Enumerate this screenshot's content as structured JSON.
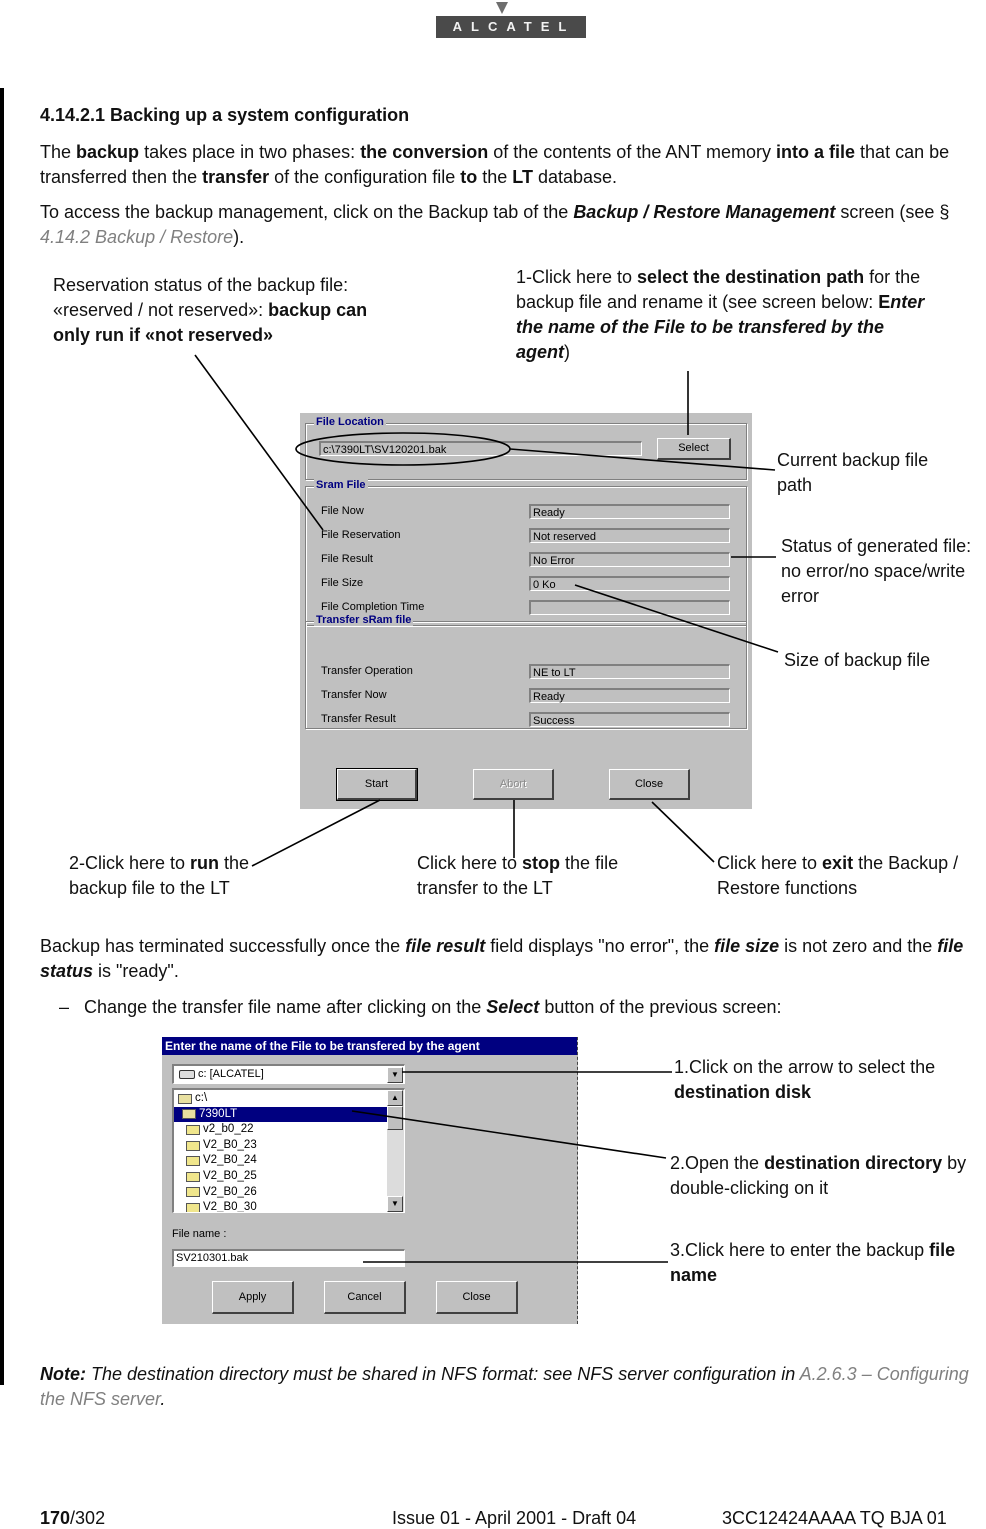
{
  "logo": {
    "text": "ALCATEL"
  },
  "heading": "4.14.2.1  Backing up a system configuration",
  "para1": {
    "t1": "The ",
    "b1": "backup",
    "t2": " takes place in two phases: ",
    "b2": "the conversion",
    "t3": " of the contents of the ANT memory ",
    "b3": "into a file",
    "t4": " that can be transferred then the ",
    "b4": "transfer",
    "t5": " of the configuration file ",
    "b5": "to",
    "t6": " the ",
    "b6": "LT",
    "t7": " database."
  },
  "para2": {
    "t1": "To access the backup management, click on the Backup tab of the ",
    "bi1": "Backup  / Restore Management",
    "t2": " screen (see § ",
    "ref": "4.14.2 Backup / Restore",
    "t3": ")."
  },
  "annotations_top": {
    "reservation": {
      "t1": "Reservation status of the backup file: «reserved / not reserved»: ",
      "b1": "backup can only run if «not reserved»"
    },
    "select": {
      "t1": "1-Click here to ",
      "b1": "select the destination path",
      "t2": " for the backup file and rename it (see screen below: ",
      "b2": "E",
      "bi1": "nter the name of the File to be transfered by the agent",
      "t3": ")"
    },
    "current_path": "Current backup file path",
    "status": "Status of generated file: no error/no space/write error",
    "size": "Size of backup file",
    "run": {
      "t1": "2-Click here to ",
      "b1": "run",
      "t2": " the backup file to the LT"
    },
    "stop": {
      "t1": "Click here to ",
      "b1": "stop",
      "t2": " the file transfer to the LT"
    },
    "exit": {
      "t1": "Click here to ",
      "b1": "exit",
      "t2": " the Backup / Restore functions"
    }
  },
  "backup_dialog": {
    "file_location": {
      "title": "File Location",
      "path": "c:\\7390LT\\SV120201.bak",
      "select_label": "Select"
    },
    "sram_file": {
      "title": "Sram File",
      "rows": [
        {
          "label": "File Now",
          "value": "Ready"
        },
        {
          "label": "File Reservation",
          "value": "Not reserved"
        },
        {
          "label": "File Result",
          "value": "No Error"
        },
        {
          "label": "File Size",
          "value": "0 Ko"
        },
        {
          "label": "File Completion Time",
          "value": ""
        }
      ]
    },
    "transfer": {
      "title": "Transfer sRam file",
      "rows": [
        {
          "label": "Transfer Operation",
          "value": "NE to LT"
        },
        {
          "label": "Transfer Now",
          "value": "Ready"
        },
        {
          "label": "Transfer Result",
          "value": "Success"
        }
      ]
    },
    "buttons": {
      "start": "Start",
      "abort": "Abort",
      "close": "Close"
    }
  },
  "para3": {
    "t1": "Backup has terminated successfully once the ",
    "bi1": "file result",
    "t2": " field displays \"no error\", the ",
    "bi2": "file size",
    "t3": " is not zero and the ",
    "bi3": "file status",
    "t4": " is \"ready\"."
  },
  "bullet": {
    "dash": "–",
    "t1": "Change the transfer file name after clicking on the ",
    "bi1": "Select",
    "t2": " button of the previous screen:"
  },
  "file_dialog": {
    "title": "Enter the name of the File to be transfered by the agent",
    "drive": "c: [ALCATEL]",
    "folders": [
      {
        "name": "c:\\",
        "open": true,
        "selected": false
      },
      {
        "name": "7390LT",
        "open": true,
        "selected": true
      },
      {
        "name": "v2_b0_22",
        "open": false,
        "selected": false
      },
      {
        "name": "V2_B0_23",
        "open": false,
        "selected": false
      },
      {
        "name": "V2_B0_24",
        "open": false,
        "selected": false
      },
      {
        "name": "V2_B0_25",
        "open": false,
        "selected": false
      },
      {
        "name": "V2_B0_26",
        "open": false,
        "selected": false
      },
      {
        "name": "V2_B0_30",
        "open": false,
        "selected": false
      }
    ],
    "file_name_label": "File name :",
    "file_name": "SV210301.bak",
    "buttons": {
      "apply": "Apply",
      "cancel": "Cancel",
      "close": "Close"
    }
  },
  "annotations_bottom": {
    "disk": {
      "t1": "1.Click on the arrow to select the ",
      "b1": "destination disk"
    },
    "dir": {
      "t1": "2.Open the ",
      "b1": "destination directory",
      "t2": " by double-clicking on it"
    },
    "name": {
      "t1": "3.Click here to enter the backup ",
      "b1": "file name"
    }
  },
  "note": {
    "label": "Note:",
    "text": "  The destination directory must be shared in NFS format: see NFS server configuration in ",
    "ref": "A.2.6.3 – Configuring the NFS server",
    "end": "."
  },
  "footer": {
    "page": "170",
    "total": "/302",
    "issue": "Issue 01 - April 2001 - Draft 04",
    "docref": "3CC12424AAAA TQ BJA 01"
  }
}
